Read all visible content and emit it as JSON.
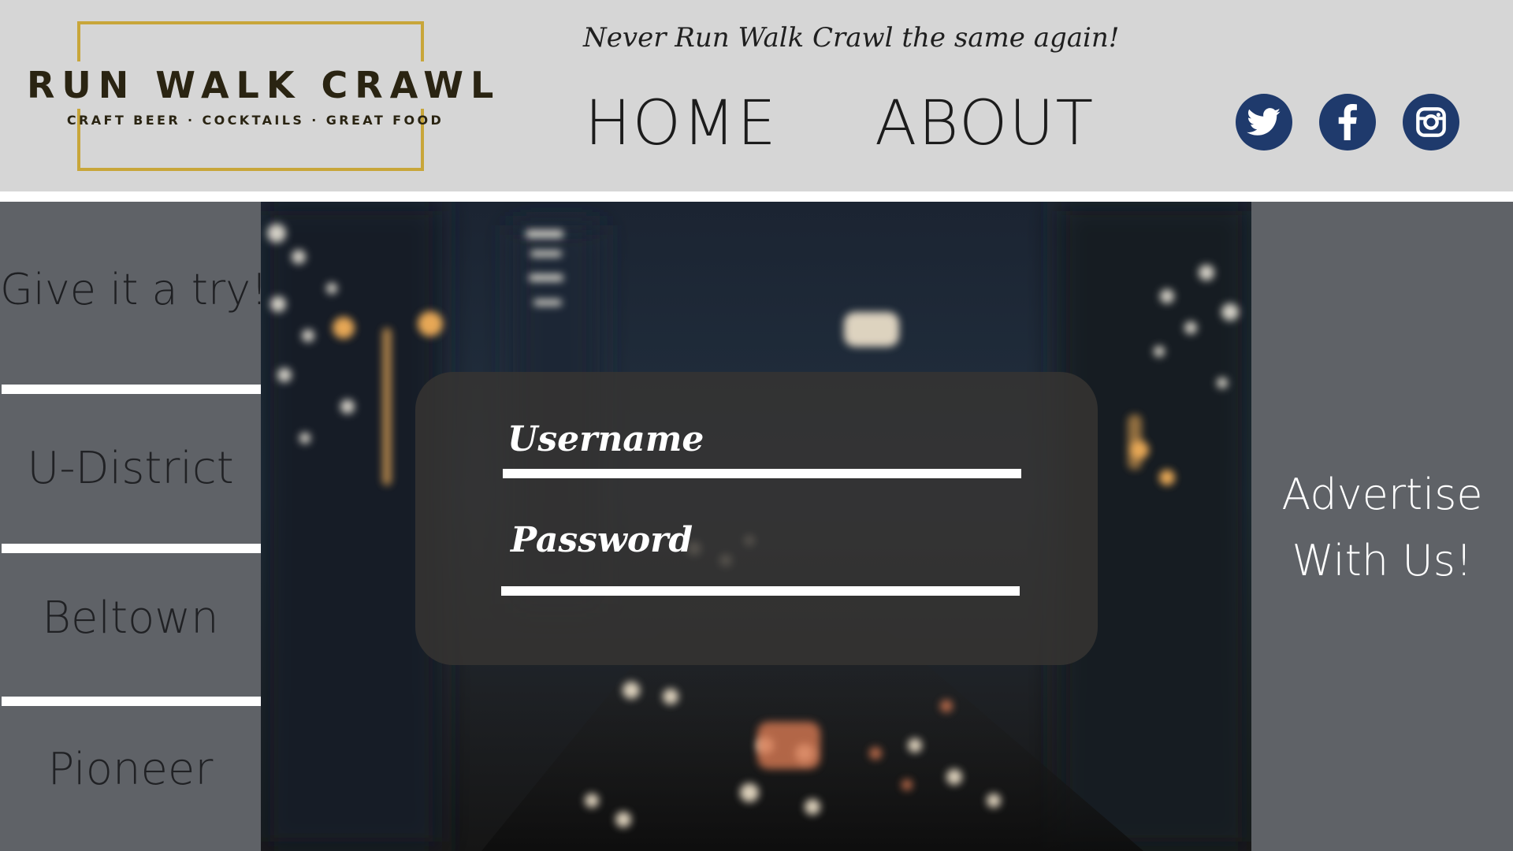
{
  "header": {
    "logo_title": "RUN WALK CRAWL",
    "logo_subtitle": "CRAFT BEER · COCKTAILS · GREAT FOOD",
    "tagline": "Never Run Walk Crawl the same again!",
    "nav": {
      "home": "HOME",
      "about": "ABOUT"
    },
    "social": [
      "twitter-icon",
      "facebook-icon",
      "instagram-icon"
    ]
  },
  "sidebar": {
    "items": [
      {
        "label": "Give it a try!"
      },
      {
        "label": "U-District"
      },
      {
        "label": "Beltown"
      },
      {
        "label": "Pioneer"
      }
    ]
  },
  "login": {
    "username_label": "Username",
    "username_value": "",
    "password_label": "Password",
    "password_value": ""
  },
  "right_sidebar": {
    "advertise_line1": "Advertise",
    "advertise_line2": "With Us!"
  },
  "colors": {
    "header_bg": "#d6d6d6",
    "sidebar_bg": "#5f6267",
    "logo_gold": "#c8a63a",
    "social_blue": "#1f3a6c"
  }
}
